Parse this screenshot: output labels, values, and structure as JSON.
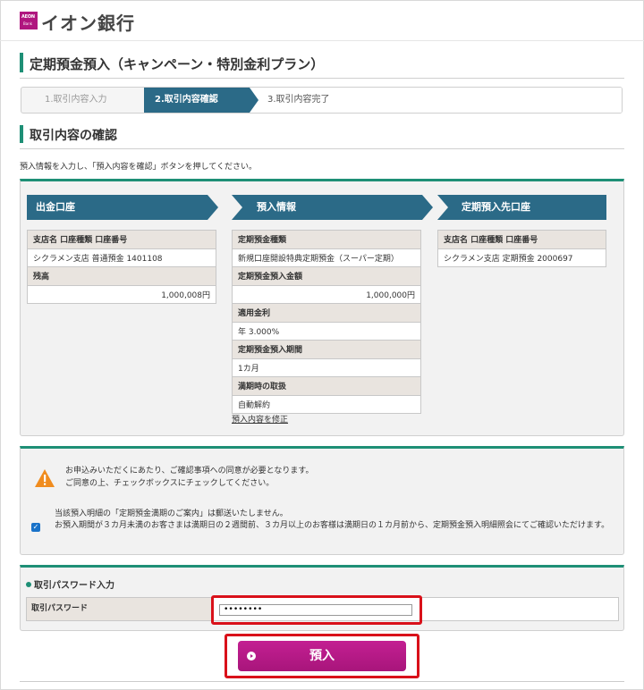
{
  "header": {
    "logo_small_top": "AEON",
    "logo_small_bottom": "Bank",
    "logo_text": "イオン銀行"
  },
  "page_title": "定期預金預入（キャンペーン・特別金利プラン）",
  "steps": [
    "1.取引内容入力",
    "2.取引内容確認",
    "3.取引内容完了"
  ],
  "section_title": "取引内容の確認",
  "intro": "預入情報を入力し、「預入内容を確認」ボタンを押してください。",
  "columns": {
    "source": {
      "heading": "出金口座",
      "branch_label": "支店名 口座種類 口座番号",
      "branch_value": "シクラメン支店 普通預金 1401108",
      "balance_label": "残高",
      "balance_value": "1,000,008円"
    },
    "deposit": {
      "heading": "預入情報",
      "type_label": "定期預金種類",
      "type_value": "新規口座開設特典定期預金（スーパー定期）",
      "amount_label": "定期預金預入金額",
      "amount_value": "1,000,000円",
      "rate_label": "適用金利",
      "rate_value": "年 3.000%",
      "term_label": "定期預金預入期間",
      "term_value": "1カ月",
      "maturity_label": "満期時の取扱",
      "maturity_value": "自動解約",
      "edit_link": "預入内容を修正"
    },
    "destination": {
      "heading": "定期預入先口座",
      "branch_label": "支店名 口座種類 口座番号",
      "branch_value": "シクラメン支店 定期預金 2000697"
    }
  },
  "consent": {
    "warning_line1": "お申込みいただくにあたり、ご確認事項への同意が必要となります。",
    "warning_line2": "ご同意の上、チェックボックスにチェックしてください。",
    "checked": true,
    "notice_line1": "当該預入明細の「定期預金満期のご案内」は郵送いたしません。",
    "notice_line2": "お預入期間が３カ月未満のお客さまは満期日の２週間前、３カ月以上のお客様は満期日の１カ月前から、定期預金預入明細照会にてご確認いただけます。"
  },
  "password": {
    "heading": "取引パスワード入力",
    "label": "取引パスワード",
    "value": "••••••••"
  },
  "submit_label": "預入",
  "colors": {
    "accent_green": "#1e8f76",
    "header_blue": "#2b6a87",
    "brand_magenta": "#b0167f",
    "highlight_red": "#d9111a"
  }
}
